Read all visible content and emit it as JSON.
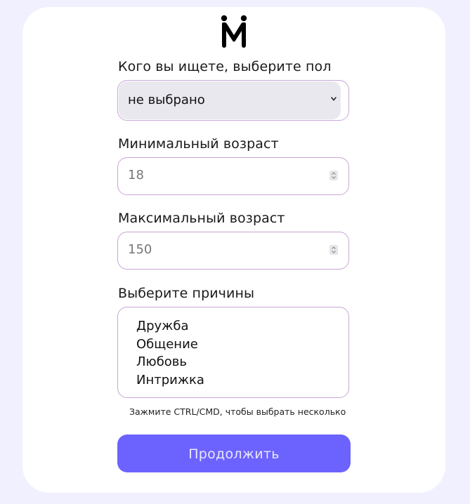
{
  "form": {
    "gender_label": "Кого вы ищете, выберите пол",
    "gender_value": "не выбрано",
    "min_age_label": "Минимальный возраст",
    "min_age_value": "18",
    "max_age_label": "Максимальный возраст",
    "max_age_value": "150",
    "reasons_label": "Выберите причины",
    "reasons_options": [
      "Дружба",
      "Общение",
      "Любовь",
      "Интрижка"
    ],
    "reasons_hint": "Зажмите CTRL/CMD, чтобы выбрать несколько",
    "continue_label": "Продолжить"
  },
  "colors": {
    "page_bg": "#f0f0fe",
    "card_bg": "#ffffff",
    "field_border": "#c9a6d6",
    "select_bg": "#e9e8ee",
    "button_bg": "#6c63ff",
    "button_text": "#e9e7ff"
  },
  "icons": {
    "logo": "logo-m-icon",
    "select_arrow": "chevron-down-icon",
    "number_spinner": "spinner-icon"
  }
}
